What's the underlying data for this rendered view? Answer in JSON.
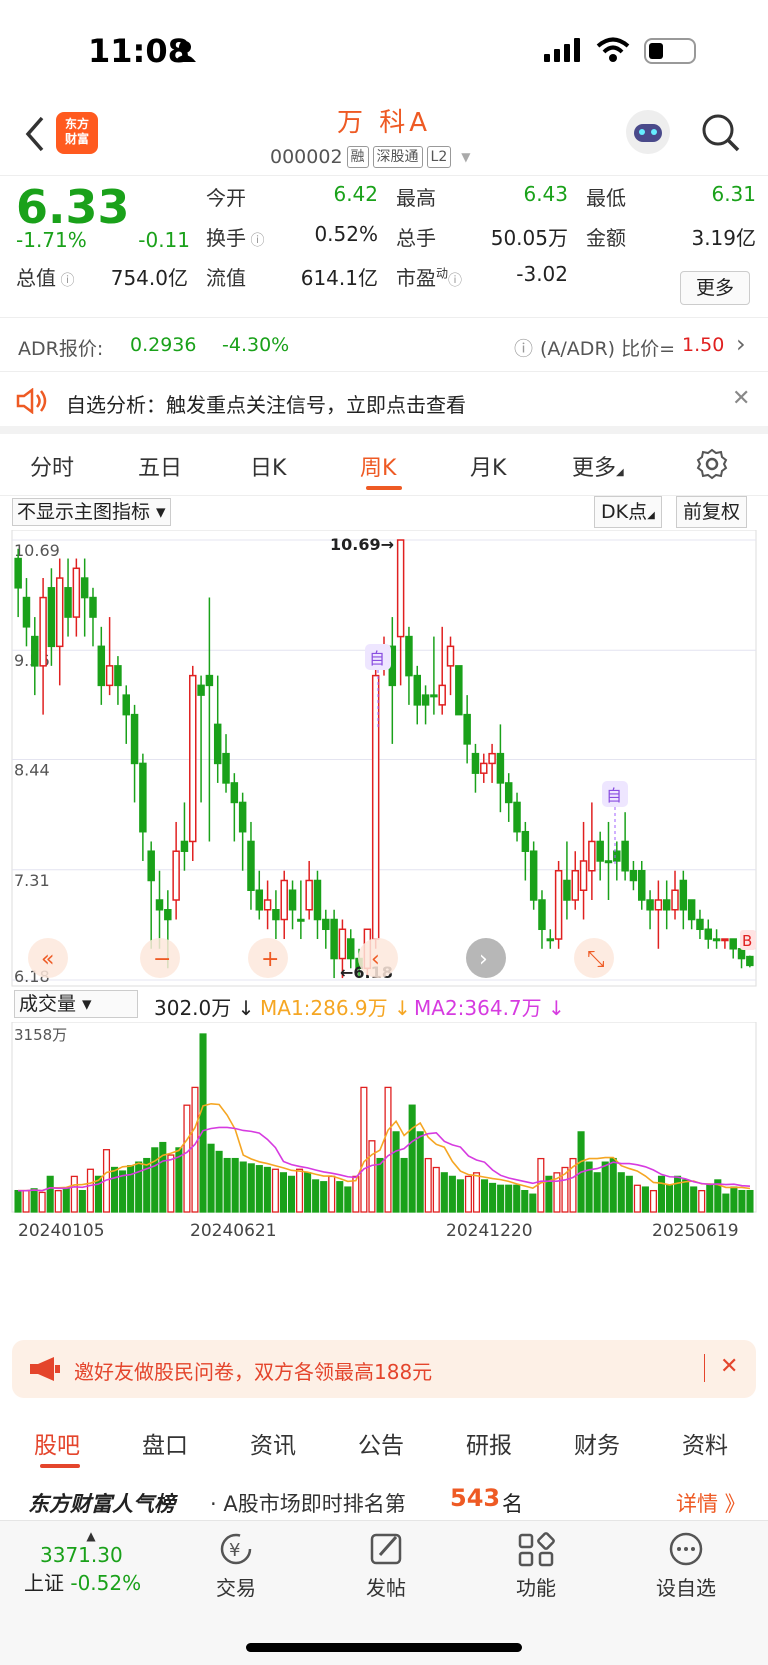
{
  "status": {
    "time": "11:08"
  },
  "header": {
    "logo_line1": "东方",
    "logo_line2": "财富",
    "name": "万 科A",
    "code": "000002",
    "tags": [
      "融",
      "深股通",
      "L2"
    ]
  },
  "quote": {
    "price": "6.33",
    "change_pct": "-1.71%",
    "change": "-0.11",
    "open_label": "今开",
    "open": "6.42",
    "high_label": "最高",
    "high": "6.43",
    "low_label": "最低",
    "low": "6.31",
    "turnover_label": "换手",
    "turnover": "0.52%",
    "volume_label": "总手",
    "volume": "50.05万",
    "amount_label": "金额",
    "amount": "3.19亿",
    "mktcap_label": "总值",
    "mktcap": "754.0亿",
    "float_label": "流值",
    "float": "614.1亿",
    "pe_label": "市盈",
    "pe_sup": "动",
    "pe": "-3.02",
    "more_label": "更多"
  },
  "adr": {
    "label": "ADR报价:",
    "price": "0.2936",
    "pct": "-4.30%",
    "ratio_label": "(A/ADR) 比价=",
    "ratio": "1.50"
  },
  "notice": {
    "text": "自选分析：触发重点关注信号，立即点击查看"
  },
  "tabs": [
    "分时",
    "五日",
    "日K",
    "周K",
    "月K",
    "更多"
  ],
  "active_tab": "周K",
  "chart_controls": {
    "indicator": "不显示主图指标",
    "dk": "DK点",
    "adjust": "前复权"
  },
  "chart_data": {
    "type": "candlestick",
    "y_ticks": [
      "10.69",
      "9.56",
      "8.44",
      "7.31",
      "6.18"
    ],
    "ylim": [
      6.18,
      10.69
    ],
    "max_label": "10.69",
    "min_label": "6.18",
    "markers": [
      "自",
      "自",
      "B"
    ],
    "candles": [
      [
        10.2,
        10.5,
        9.9,
        10.6,
        0
      ],
      [
        10.1,
        9.8,
        9.6,
        10.3,
        0
      ],
      [
        9.7,
        9.4,
        9.1,
        9.9,
        0
      ],
      [
        9.4,
        10.1,
        8.9,
        10.3,
        1
      ],
      [
        10.2,
        9.6,
        9.4,
        10.4,
        0
      ],
      [
        9.6,
        10.3,
        9.2,
        10.5,
        1
      ],
      [
        10.2,
        9.9,
        9.7,
        10.5,
        0
      ],
      [
        9.9,
        10.4,
        9.7,
        10.5,
        1
      ],
      [
        10.3,
        10.1,
        9.7,
        10.5,
        0
      ],
      [
        10.1,
        9.9,
        9.6,
        10.2,
        0
      ],
      [
        9.6,
        9.2,
        9.0,
        9.8,
        0
      ],
      [
        9.2,
        9.4,
        9.1,
        9.9,
        1
      ],
      [
        9.4,
        9.2,
        9.0,
        9.5,
        0
      ],
      [
        9.1,
        8.9,
        8.6,
        9.2,
        0
      ],
      [
        8.9,
        8.4,
        8.0,
        9.0,
        0
      ],
      [
        8.4,
        7.7,
        7.4,
        8.5,
        0
      ],
      [
        7.5,
        7.2,
        6.5,
        7.6,
        0
      ],
      [
        7.0,
        6.9,
        6.5,
        7.3,
        0
      ],
      [
        6.9,
        6.8,
        6.3,
        7.1,
        0
      ],
      [
        7.0,
        7.5,
        6.8,
        7.8,
        1
      ],
      [
        7.6,
        7.5,
        7.3,
        8.0,
        0
      ],
      [
        7.6,
        9.3,
        7.4,
        9.4,
        1
      ],
      [
        9.2,
        9.1,
        8.0,
        9.3,
        0
      ],
      [
        9.3,
        9.2,
        7.6,
        10.1,
        0
      ],
      [
        8.8,
        8.4,
        8.2,
        9.3,
        0
      ],
      [
        8.5,
        8.2,
        8.1,
        8.7,
        0
      ],
      [
        8.2,
        8.0,
        7.6,
        8.3,
        0
      ],
      [
        8.0,
        7.7,
        7.3,
        8.1,
        0
      ],
      [
        7.6,
        7.1,
        6.9,
        7.8,
        0
      ],
      [
        7.1,
        6.9,
        6.8,
        7.3,
        0
      ],
      [
        6.9,
        7.0,
        6.7,
        7.2,
        1
      ],
      [
        6.9,
        6.8,
        6.6,
        7.1,
        0
      ],
      [
        6.8,
        7.2,
        6.6,
        7.3,
        1
      ],
      [
        7.1,
        6.9,
        6.7,
        7.2,
        0
      ],
      [
        6.8,
        6.8,
        6.6,
        7.2,
        0
      ],
      [
        6.9,
        7.2,
        6.8,
        7.4,
        1
      ],
      [
        7.2,
        6.8,
        6.6,
        7.3,
        0
      ],
      [
        6.8,
        6.7,
        6.5,
        6.9,
        0
      ],
      [
        6.8,
        6.4,
        6.2,
        6.9,
        0
      ],
      [
        6.4,
        6.7,
        6.2,
        6.8,
        1
      ],
      [
        6.6,
        6.4,
        6.3,
        6.7,
        0
      ],
      [
        6.4,
        6.3,
        6.2,
        6.5,
        0
      ],
      [
        6.3,
        6.7,
        6.2,
        6.7,
        1
      ],
      [
        6.6,
        9.3,
        6.5,
        9.4,
        1
      ],
      [
        9.4,
        9.6,
        9.3,
        9.7,
        1
      ],
      [
        9.6,
        9.2,
        8.6,
        9.9,
        0
      ],
      [
        9.7,
        10.69,
        9.2,
        10.69,
        1
      ],
      [
        9.7,
        9.3,
        9.0,
        9.8,
        0
      ],
      [
        9.3,
        9.0,
        8.8,
        9.4,
        0
      ],
      [
        9.1,
        9.0,
        8.8,
        9.2,
        0
      ],
      [
        9.1,
        9.1,
        8.9,
        9.7,
        0
      ],
      [
        9.0,
        9.2,
        8.9,
        9.8,
        1
      ],
      [
        9.4,
        9.6,
        9.1,
        9.7,
        1
      ],
      [
        9.4,
        8.9,
        8.9,
        9.4,
        0
      ],
      [
        8.9,
        8.6,
        8.4,
        9.1,
        0
      ],
      [
        8.5,
        8.3,
        8.1,
        8.6,
        0
      ],
      [
        8.3,
        8.4,
        8.2,
        8.5,
        1
      ],
      [
        8.4,
        8.5,
        8.2,
        8.6,
        1
      ],
      [
        8.5,
        8.2,
        7.9,
        8.8,
        0
      ],
      [
        8.2,
        8.0,
        7.8,
        8.3,
        0
      ],
      [
        8.0,
        7.7,
        7.6,
        8.1,
        0
      ],
      [
        7.7,
        7.5,
        7.2,
        7.8,
        0
      ],
      [
        7.5,
        7.0,
        6.9,
        7.6,
        0
      ],
      [
        7.0,
        6.7,
        6.5,
        7.1,
        0
      ],
      [
        6.6,
        6.6,
        6.5,
        6.7,
        0
      ],
      [
        6.6,
        7.3,
        6.5,
        7.4,
        1
      ],
      [
        7.2,
        7.0,
        6.8,
        7.6,
        0
      ],
      [
        7.0,
        7.3,
        6.9,
        7.5,
        1
      ],
      [
        7.1,
        7.4,
        6.8,
        7.8,
        1
      ],
      [
        7.3,
        7.6,
        7.0,
        8.0,
        1
      ],
      [
        7.6,
        7.4,
        7.2,
        7.7,
        0
      ],
      [
        7.4,
        7.4,
        7.0,
        7.8,
        0
      ],
      [
        7.5,
        7.4,
        7.2,
        7.6,
        0
      ],
      [
        7.6,
        7.3,
        7.2,
        7.9,
        0
      ],
      [
        7.3,
        7.2,
        7.1,
        7.4,
        0
      ],
      [
        7.3,
        7.0,
        6.9,
        7.4,
        0
      ],
      [
        7.0,
        6.9,
        6.7,
        7.1,
        0
      ],
      [
        6.9,
        7.0,
        6.5,
        7.2,
        1
      ],
      [
        7.0,
        6.9,
        6.7,
        7.2,
        0
      ],
      [
        6.9,
        7.1,
        6.8,
        7.3,
        1
      ],
      [
        7.2,
        6.9,
        6.7,
        7.3,
        0
      ],
      [
        7.0,
        6.8,
        6.7,
        7.0,
        0
      ],
      [
        6.8,
        6.7,
        6.6,
        6.9,
        0
      ],
      [
        6.7,
        6.6,
        6.5,
        6.8,
        0
      ],
      [
        6.6,
        6.6,
        6.5,
        6.7,
        0
      ],
      [
        6.6,
        6.6,
        6.5,
        6.6,
        1
      ],
      [
        6.6,
        6.5,
        6.4,
        6.6,
        0
      ],
      [
        6.5,
        6.4,
        6.3,
        6.6,
        0
      ],
      [
        6.42,
        6.33,
        6.31,
        6.43,
        0
      ]
    ]
  },
  "volume_chart": {
    "selector": "成交量",
    "vol": "302.0万",
    "ma1": "MA1:286.9万",
    "ma2": "MA2:364.7万",
    "max_label": "3158万",
    "dates": [
      "20240105",
      "20240621",
      "20241220",
      "20250619"
    ],
    "bars": [
      0.12,
      0.12,
      0.13,
      0.11,
      0.2,
      0.12,
      0.13,
      0.2,
      0.12,
      0.24,
      0.2,
      0.35,
      0.25,
      0.23,
      0.26,
      0.28,
      0.3,
      0.36,
      0.39,
      0.32,
      0.36,
      0.6,
      0.7,
      1.0,
      0.38,
      0.34,
      0.3,
      0.3,
      0.28,
      0.27,
      0.26,
      0.25,
      0.24,
      0.22,
      0.2,
      0.24,
      0.22,
      0.18,
      0.17,
      0.2,
      0.17,
      0.14,
      0.2,
      0.7,
      0.4,
      0.3,
      0.7,
      0.45,
      0.3,
      0.6,
      0.45,
      0.3,
      0.25,
      0.22,
      0.2,
      0.18,
      0.2,
      0.22,
      0.18,
      0.16,
      0.15,
      0.15,
      0.15,
      0.12,
      0.1,
      0.3,
      0.2,
      0.22,
      0.25,
      0.3,
      0.45,
      0.28,
      0.22,
      0.28,
      0.3,
      0.22,
      0.2,
      0.15,
      0.14,
      0.12,
      0.2,
      0.15,
      0.2,
      0.18,
      0.14,
      0.12,
      0.15,
      0.18,
      0.1,
      0.14,
      0.12,
      0.12
    ],
    "up": [
      0,
      1,
      0,
      1,
      0,
      1,
      0,
      1,
      0,
      1,
      0,
      1,
      0,
      0,
      0,
      0,
      0,
      0,
      0,
      1,
      0,
      1,
      1,
      0,
      0,
      0,
      0,
      0,
      0,
      0,
      0,
      0,
      1,
      0,
      0,
      1,
      0,
      0,
      0,
      1,
      0,
      0,
      1,
      1,
      1,
      0,
      1,
      0,
      0,
      0,
      0,
      1,
      1,
      0,
      0,
      0,
      1,
      1,
      0,
      0,
      0,
      0,
      0,
      0,
      0,
      1,
      0,
      1,
      1,
      1,
      0,
      0,
      0,
      0,
      0,
      0,
      0,
      1,
      0,
      1,
      0,
      0,
      0,
      0,
      0,
      1,
      0,
      0,
      0,
      0,
      0,
      0
    ]
  },
  "banner": {
    "text": "邀好友做股民问卷，双方各领最高188元"
  },
  "bottom_tabs": [
    "股吧",
    "盘口",
    "资讯",
    "公告",
    "研报",
    "财务",
    "资料"
  ],
  "rank": {
    "brand": "东方财富人气榜",
    "text": "· A股市场即时排名第",
    "num": "543",
    "unit": "名",
    "detail": "详情 》"
  },
  "dock": {
    "index_value": "3371.30",
    "index_name": "上证",
    "index_pct": "-0.52%",
    "items": [
      "交易",
      "发帖",
      "功能",
      "设自选"
    ]
  }
}
